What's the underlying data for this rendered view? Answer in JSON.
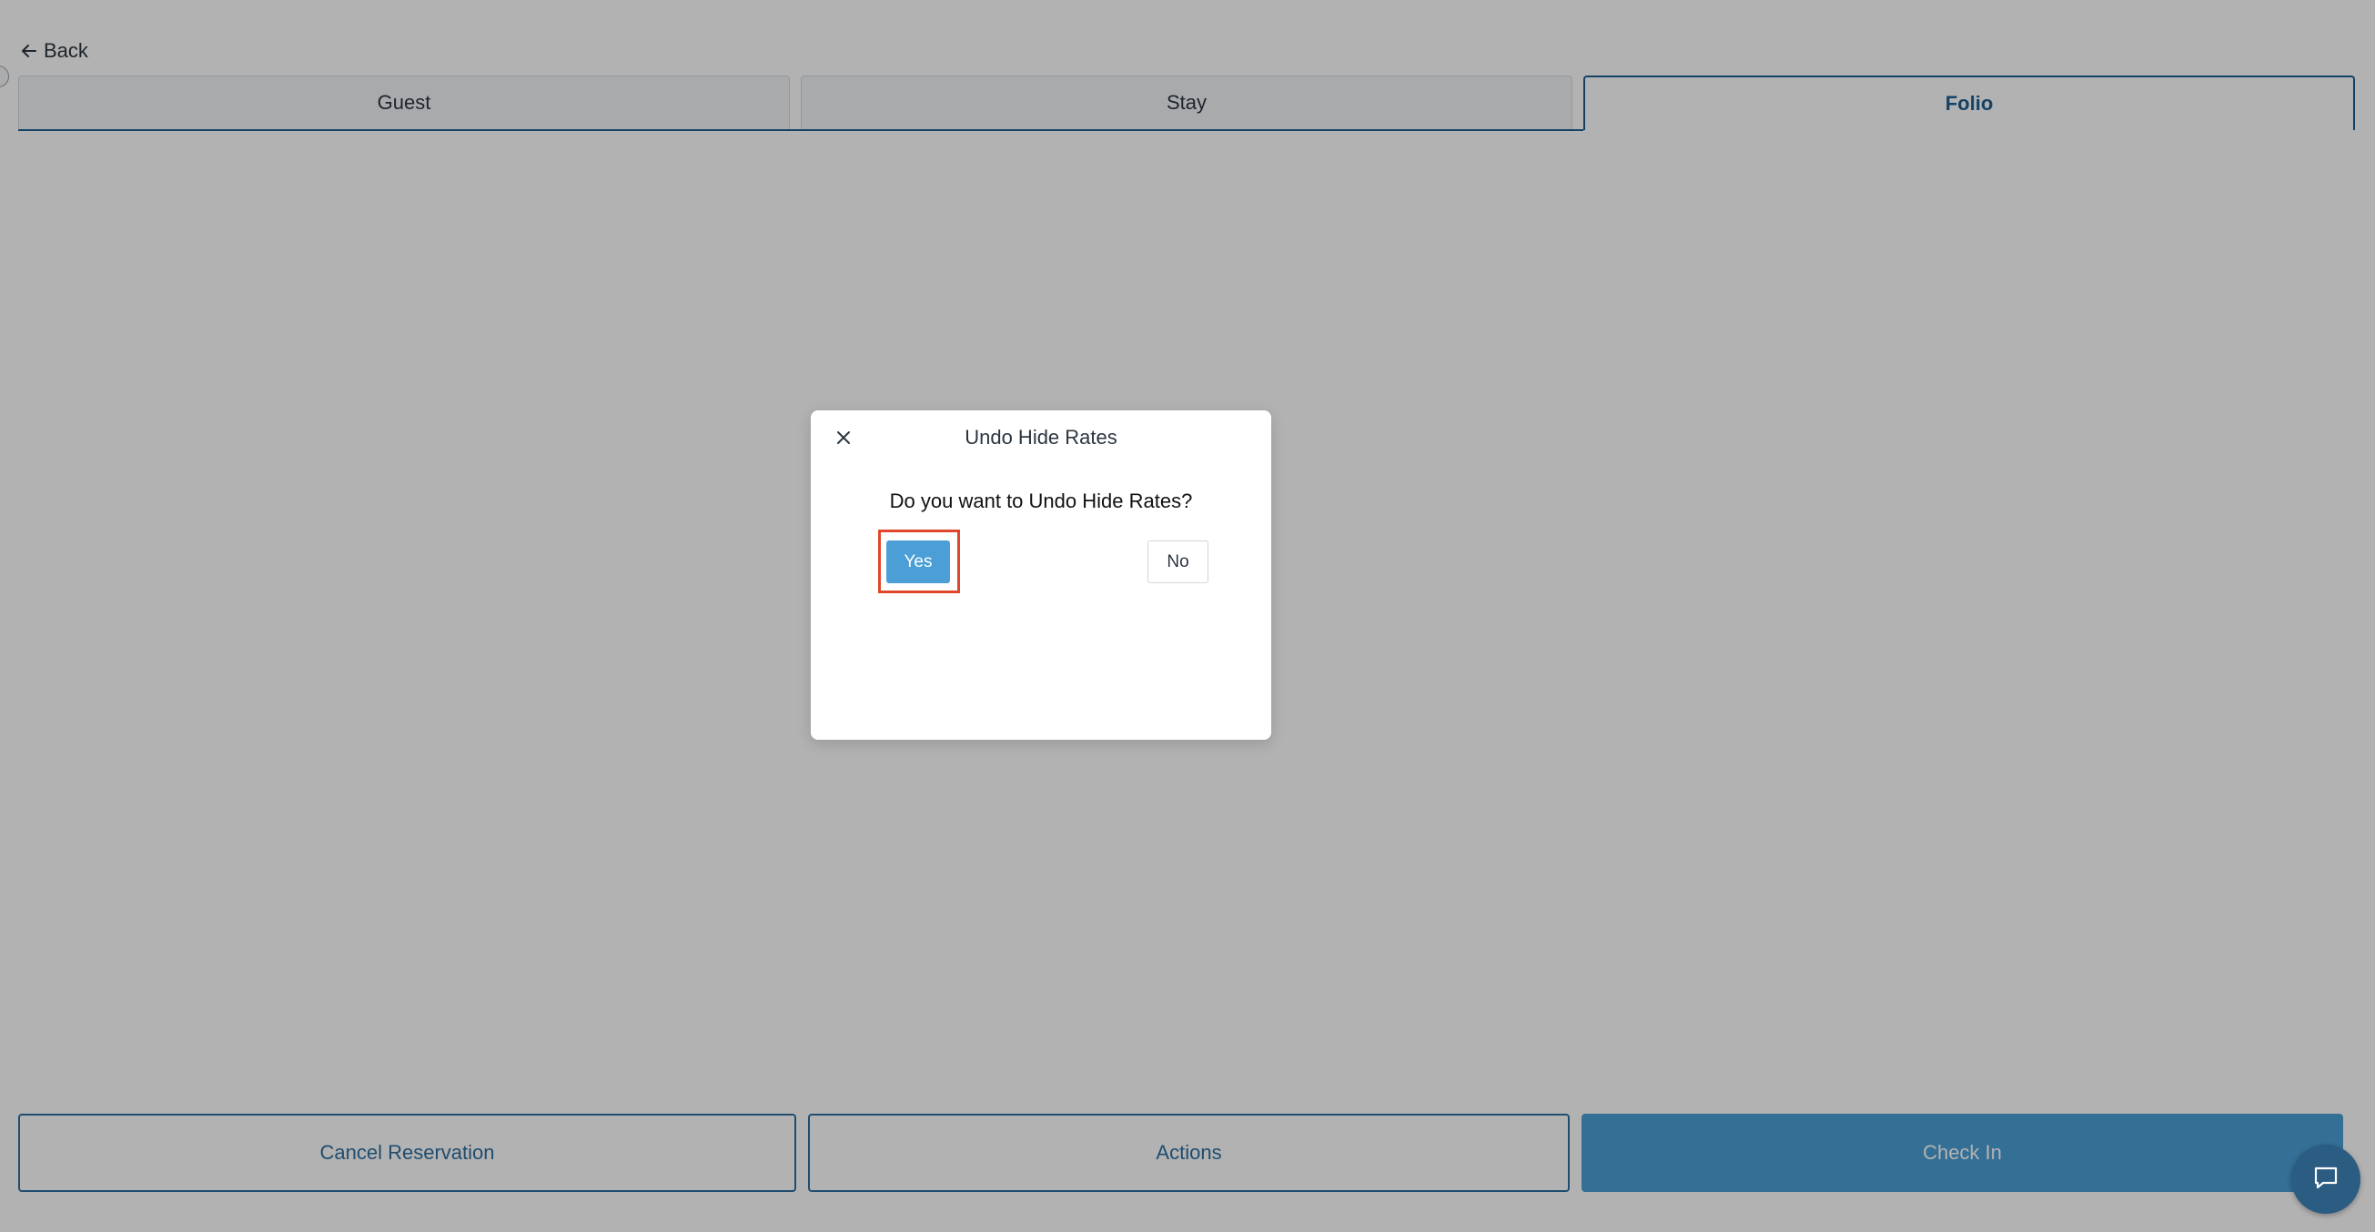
{
  "header": {
    "back_label": "Back"
  },
  "tabs": [
    {
      "label": "Guest",
      "active": false
    },
    {
      "label": "Stay",
      "active": false
    },
    {
      "label": "Folio",
      "active": true
    }
  ],
  "footer": {
    "cancel_label": "Cancel Reservation",
    "actions_label": "Actions",
    "checkin_label": "Check In"
  },
  "dialog": {
    "title": "Undo Hide Rates",
    "question": "Do you want to Undo Hide Rates?",
    "yes_label": "Yes",
    "no_label": "No",
    "close_icon": "close-icon"
  },
  "chat": {
    "icon": "chat-icon"
  },
  "colors": {
    "accent": "#1e5f91",
    "primary_button": "#4b9fd6",
    "highlight": "#e0462b",
    "chat_fab": "#2b5c82"
  }
}
